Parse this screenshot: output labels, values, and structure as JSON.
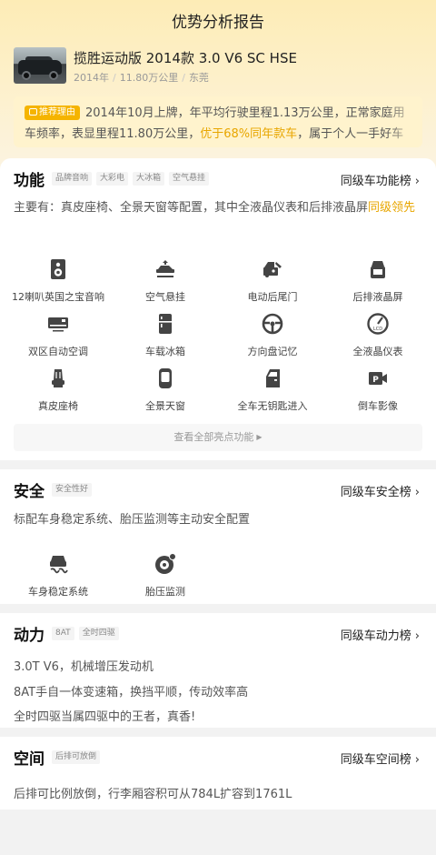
{
  "page": {
    "title": "优势分析报告"
  },
  "car": {
    "name": "揽胜运动版 2014款 3.0 V6 SC HSE",
    "year": "2014年",
    "mileage": "11.80万公里",
    "city": "东莞"
  },
  "reason": {
    "tag": "推荐理由",
    "text_before": "2014年10月上牌，年平均行驶里程1.13万公里，正常家庭用车频率，表显里程11.80万公里，",
    "highlight": "优于68%同年款车",
    "text_after": "，属于个人一手好车"
  },
  "function": {
    "title": "功能",
    "chips": [
      "品牌音响",
      "大彩电",
      "大冰箱",
      "空气悬挂"
    ],
    "rank_label": "同级车功能榜",
    "summary_before": "主要有：真皮座椅、全景天窗等配置，其中全液晶仪表和后排液晶屏",
    "summary_highlight": "同级领先",
    "features": [
      {
        "label": "12喇叭英国之宝音响",
        "icon": "speaker-icon"
      },
      {
        "label": "空气悬挂",
        "icon": "air-suspension-icon"
      },
      {
        "label": "电动后尾门",
        "icon": "power-tailgate-icon"
      },
      {
        "label": "后排液晶屏",
        "icon": "rear-screen-icon"
      },
      {
        "label": "双区自动空调",
        "icon": "dual-zone-ac-icon"
      },
      {
        "label": "车载冰箱",
        "icon": "car-fridge-icon"
      },
      {
        "label": "方向盘记忆",
        "icon": "steering-wheel-icon"
      },
      {
        "label": "全液晶仪表",
        "icon": "lcd-dashboard-icon"
      },
      {
        "label": "真皮座椅",
        "icon": "leather-seat-icon"
      },
      {
        "label": "全景天窗",
        "icon": "panoramic-sunroof-icon"
      },
      {
        "label": "全车无钥匙进入",
        "icon": "keyless-entry-icon"
      },
      {
        "label": "倒车影像",
        "icon": "reverse-camera-icon"
      }
    ],
    "more_label": "查看全部亮点功能"
  },
  "safety": {
    "title": "安全",
    "chips": [
      "安全性好"
    ],
    "rank_label": "同级车安全榜",
    "summary": "标配车身稳定系统、胎压监测等主动安全配置",
    "features": [
      {
        "label": "车身稳定系统",
        "icon": "stability-control-icon"
      },
      {
        "label": "胎压监测",
        "icon": "tire-pressure-icon"
      }
    ]
  },
  "power": {
    "title": "动力",
    "chips": [
      "8AT",
      "全时四驱"
    ],
    "rank_label": "同级车动力榜",
    "lines": [
      "3.0T V6，机械增压发动机",
      "8AT手自一体变速箱，换挡平顺，传动效率高",
      "全时四驱当属四驱中的王者，真香!"
    ]
  },
  "space": {
    "title": "空间",
    "chips": [
      "后排可放倒"
    ],
    "rank_label": "同级车空间榜",
    "summary": "后排可比例放倒，行李厢容积可从784L扩容到1761L"
  },
  "colors": {
    "accent": "#e8a600",
    "tag_bg": "#f5b400",
    "hero_bg": "#fdecb6"
  }
}
